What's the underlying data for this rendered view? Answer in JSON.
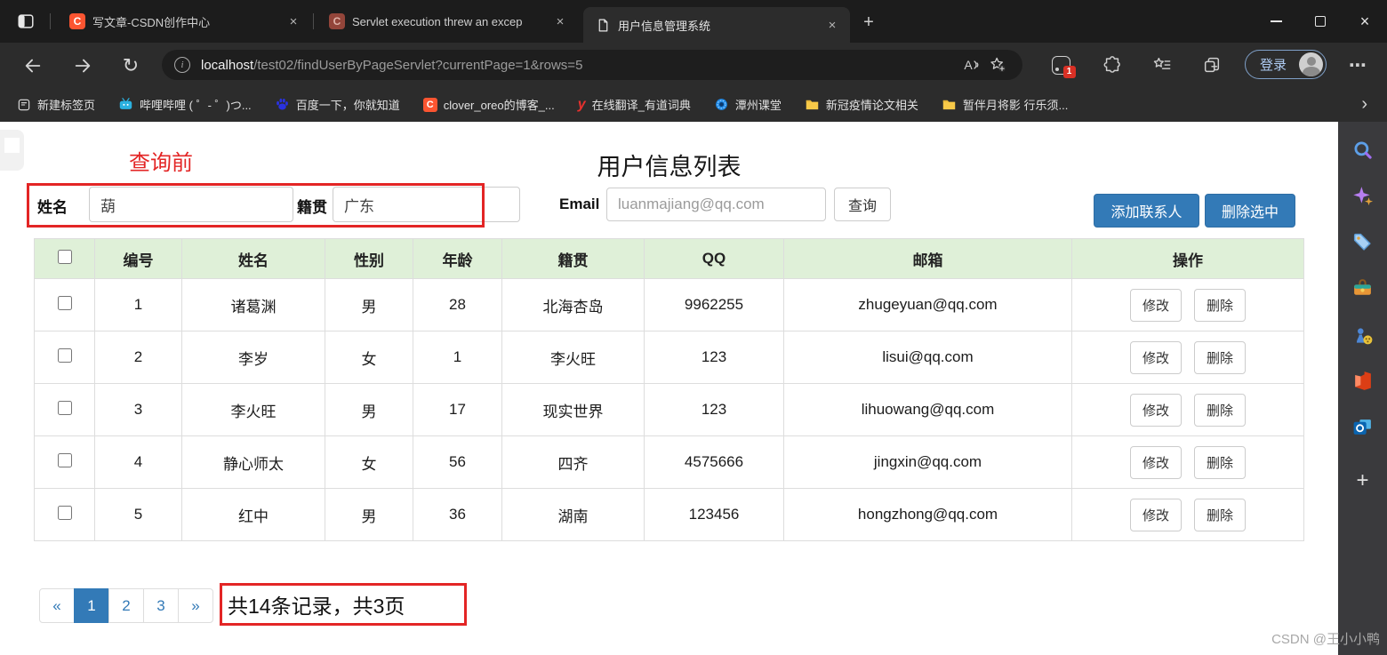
{
  "colors": {
    "accent_blue": "#337ab7",
    "table_header_green": "#dff0d8",
    "annotation_red": "#e32525",
    "csdn_orange": "#fc5531"
  },
  "icons": {
    "close": "×",
    "plus": "+",
    "menu": "⋯",
    "chevron_right": "›",
    "refresh": "↻",
    "info": "i",
    "read_aloud_letter": "A",
    "csdn_letter": "C",
    "youdao_letter": "y"
  },
  "titlebar": {
    "tabs": [
      {
        "title": "写文章-CSDN创作中心"
      },
      {
        "title": "Servlet execution threw an excep"
      },
      {
        "title": "用户信息管理系统"
      }
    ]
  },
  "toolbar": {
    "url_host": "localhost",
    "url_path": "/test02/findUserByPageServlet?currentPage=1&rows=5",
    "badge_count": "1",
    "login_label": "登录"
  },
  "bookmarks": [
    {
      "label": "新建标签页",
      "icon": "newtab-icon"
    },
    {
      "label": "哔哩哔哩 ( ゜- ゜)つ...",
      "icon": "bilibili-icon"
    },
    {
      "label": "百度一下，你就知道",
      "icon": "baidu-icon"
    },
    {
      "label": "clover_oreo的博客_...",
      "icon": "csdn-icon"
    },
    {
      "label": "在线翻译_有道词典",
      "icon": "youdao-icon"
    },
    {
      "label": "潭州课堂",
      "icon": "tanzhou-icon"
    },
    {
      "label": "新冠疫情论文相关",
      "icon": "folder-icon"
    },
    {
      "label": "暂伴月将影 行乐须...",
      "icon": "folder-icon"
    }
  ],
  "page": {
    "annotation_before": "查询前",
    "title": "用户信息列表",
    "form": {
      "name_label": "姓名",
      "name_value": "葫",
      "origin_label": "籍贯",
      "origin_value": "广东",
      "email_label": "Email",
      "email_placeholder": "luanmajiang@qq.com",
      "search_button": "查询",
      "add_button": "添加联系人",
      "delete_selected_button": "删除选中"
    },
    "table": {
      "headers": [
        "编号",
        "姓名",
        "性别",
        "年龄",
        "籍贯",
        "QQ",
        "邮箱",
        "操作"
      ],
      "rows": [
        {
          "id": "1",
          "name": "诸葛渊",
          "gender": "男",
          "age": "28",
          "origin": "北海杏岛",
          "qq": "9962255",
          "email": "zhugeyuan@qq.com"
        },
        {
          "id": "2",
          "name": "李岁",
          "gender": "女",
          "age": "1",
          "origin": "李火旺",
          "qq": "123",
          "email": "lisui@qq.com"
        },
        {
          "id": "3",
          "name": "李火旺",
          "gender": "男",
          "age": "17",
          "origin": "现实世界",
          "qq": "123",
          "email": "lihuowang@qq.com"
        },
        {
          "id": "4",
          "name": "静心师太",
          "gender": "女",
          "age": "56",
          "origin": "四齐",
          "qq": "4575666",
          "email": "jingxin@qq.com"
        },
        {
          "id": "5",
          "name": "红中",
          "gender": "男",
          "age": "36",
          "origin": "湖南",
          "qq": "123456",
          "email": "hongzhong@qq.com"
        }
      ],
      "edit_button": "修改",
      "delete_button": "删除"
    },
    "pagination": {
      "prev": "«",
      "pages": [
        "1",
        "2",
        "3"
      ],
      "next": "»",
      "active_page": "1",
      "summary": "共14条记录，共3页"
    }
  },
  "watermark": "CSDN @王小小鸭"
}
